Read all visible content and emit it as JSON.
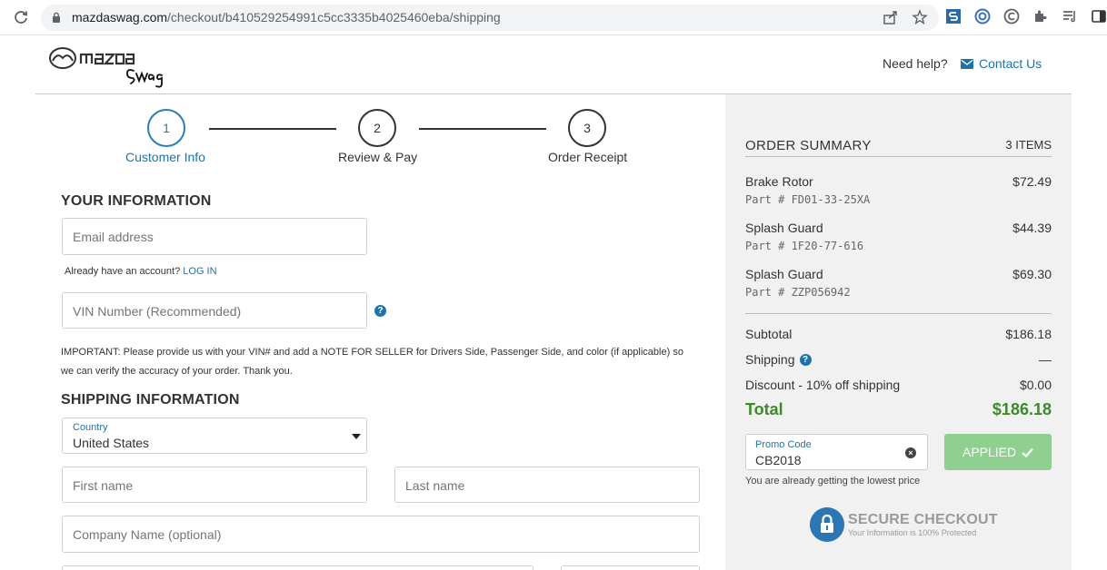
{
  "browser": {
    "url_host": "mazdaswag.com",
    "url_path": "/checkout/b410529254991c5cc3335b4025460eba/shipping"
  },
  "header": {
    "need_help": "Need help?",
    "contact_label": "Contact Us"
  },
  "steps": [
    {
      "number": "1",
      "label": "Customer Info",
      "active": true
    },
    {
      "number": "2",
      "label": "Review & Pay",
      "active": false
    },
    {
      "number": "3",
      "label": "Order Receipt",
      "active": false
    }
  ],
  "your_info": {
    "title": "YOUR INFORMATION",
    "email_placeholder": "Email address",
    "account_prompt": "Already have an account?",
    "login_label": "LOG IN",
    "vin_placeholder": "VIN Number (Recommended)",
    "important_note": "IMPORTANT: Please provide us with your VIN# and add a NOTE FOR SELLER for Drivers Side, Passenger Side, and color (if applicable) so we can verify the accuracy of your order. Thank you."
  },
  "shipping": {
    "title": "SHIPPING INFORMATION",
    "country_label": "Country",
    "country_value": "United States",
    "first_name_placeholder": "First name",
    "last_name_placeholder": "Last name",
    "company_placeholder": "Company Name (optional)"
  },
  "summary": {
    "title": "ORDER SUMMARY",
    "count": "3 ITEMS",
    "items": [
      {
        "name": "Brake Rotor",
        "part": "Part # FD01-33-25XA",
        "price": "$72.49"
      },
      {
        "name": "Splash Guard",
        "part": "Part # 1F20-77-616",
        "price": "$44.39"
      },
      {
        "name": "Splash Guard",
        "part": "Part # ZZP056942",
        "price": "$69.30"
      }
    ],
    "subtotal_label": "Subtotal",
    "subtotal_value": "$186.18",
    "shipping_label": "Shipping",
    "shipping_value": "—",
    "discount_label": "Discount - 10% off shipping",
    "discount_value": "$0.00",
    "total_label": "Total",
    "total_value": "$186.18",
    "promo_label": "Promo Code",
    "promo_value": "CB2018",
    "applied_label": "APPLIED",
    "lowest_note": "You are already getting the lowest price",
    "secure_title": "SECURE CHECKOUT",
    "secure_sub": "Your Information is 100% Protected"
  },
  "colors": {
    "accent": "#1e74a8",
    "total_green": "#3a8a2a",
    "applied_green": "#8fd090",
    "summary_bg": "#f1f1f1"
  }
}
